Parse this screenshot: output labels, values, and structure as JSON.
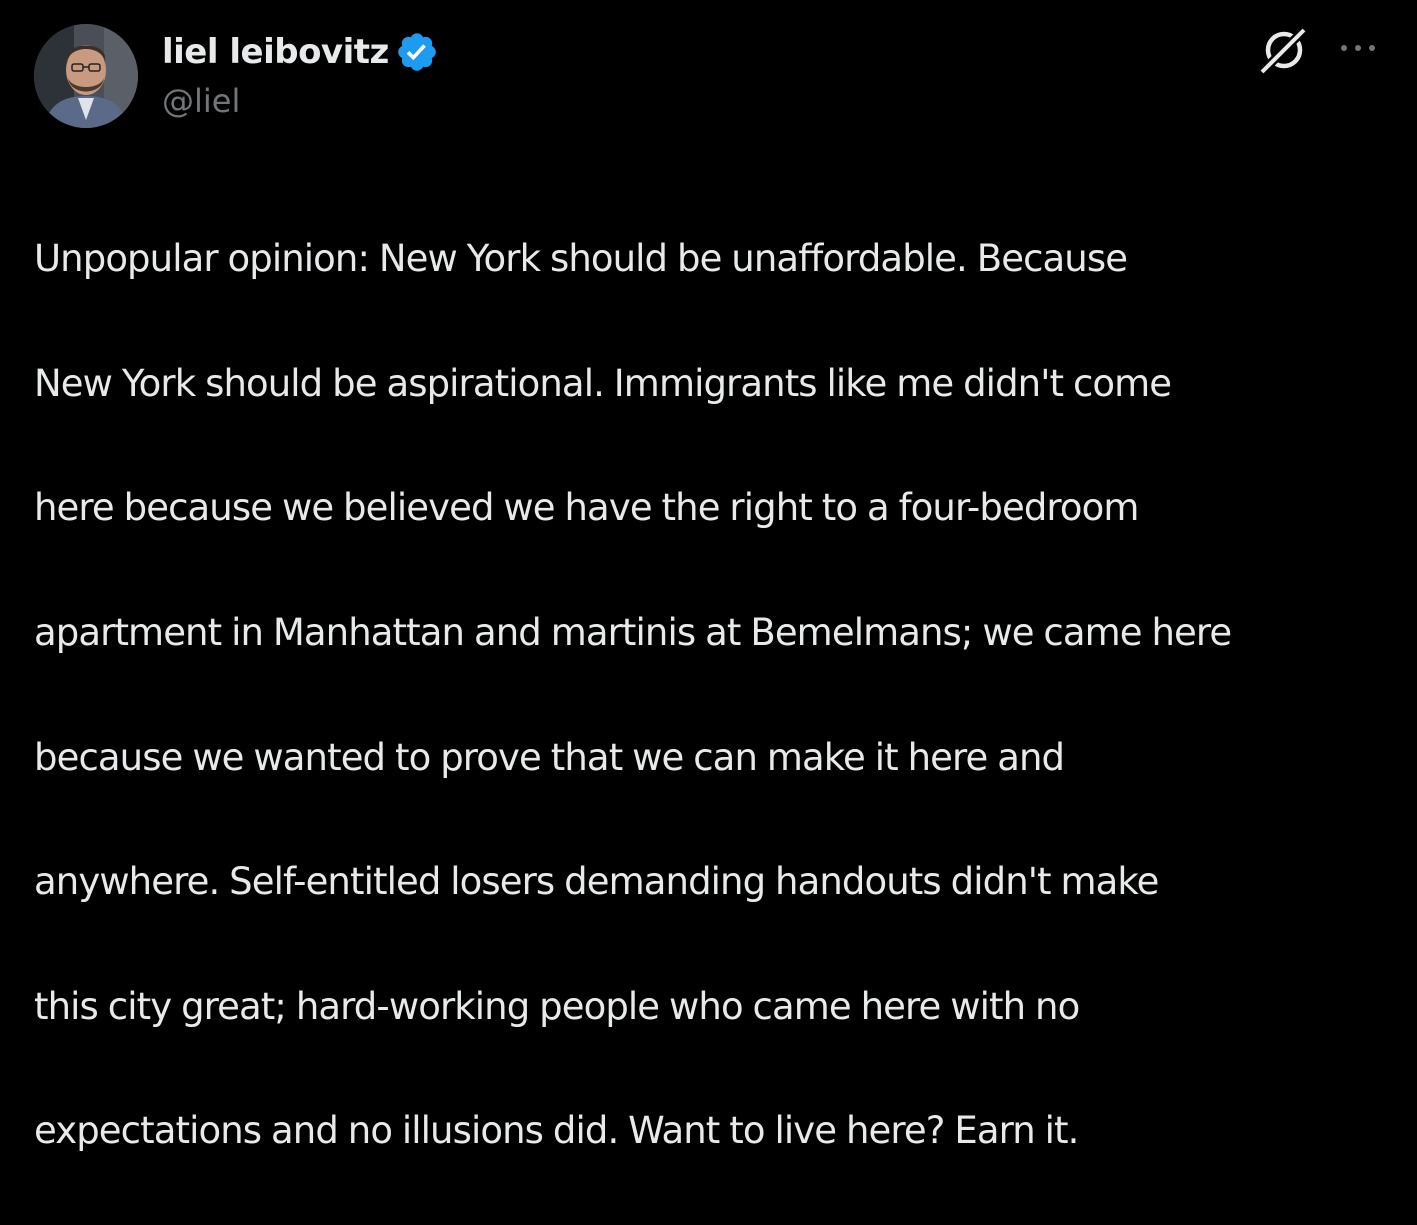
{
  "author": {
    "display_name": "liel leibovitz",
    "handle": "@liel",
    "verified": true,
    "verified_color": "#1d9bf0"
  },
  "actions": {
    "grok_icon": "grok-icon",
    "more_icon": "more-dots-icon"
  },
  "tweet": {
    "lines": [
      "Unpopular opinion: New York should be unaffordable. Because",
      "New York should be aspirational. Immigrants like me didn't come",
      "here because we believed we have the right to a four-bedroom",
      "apartment in Manhattan and martinis at Bemelmans; we came here",
      "because we wanted to prove that we can make it here and",
      "anywhere. Self-entitled losers demanding handouts didn't make",
      "this city great; hard-working people who came here with no",
      "expectations and no illusions did. Want to live here? Earn it."
    ]
  },
  "colors": {
    "background": "#000000",
    "text_primary": "#e7e9ea",
    "text_secondary": "#71767b"
  }
}
